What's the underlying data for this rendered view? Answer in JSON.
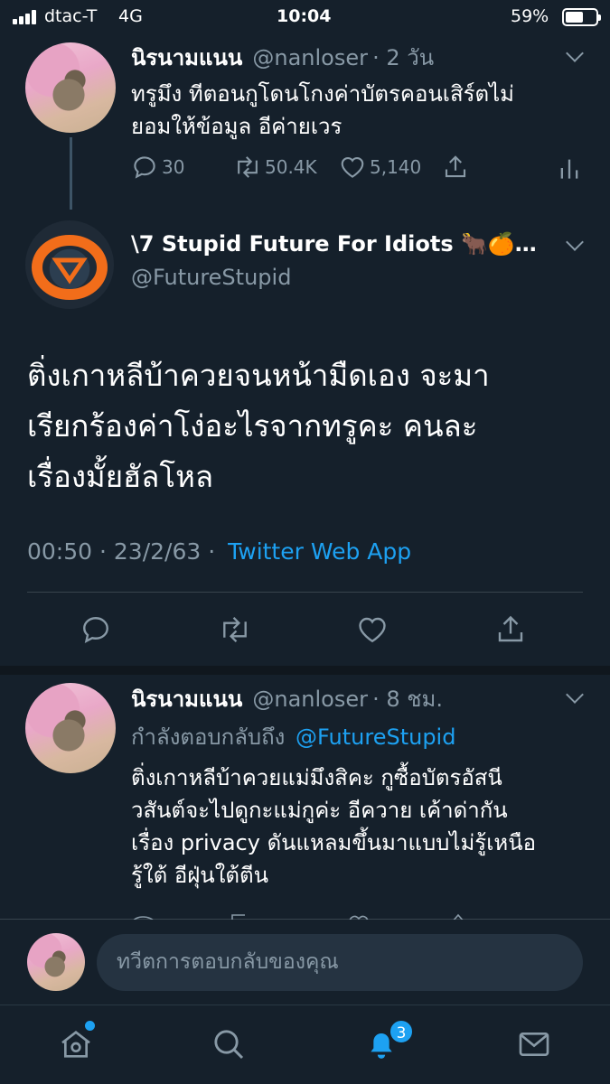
{
  "status_bar": {
    "carrier": "dtac-T",
    "network": "4G",
    "time": "10:04",
    "battery": "59%",
    "battery_level": 0.59
  },
  "parent_tweet": {
    "name": "นิรนามแนน",
    "handle": "@nanloser",
    "time": "· 2 วัน",
    "text_line1": "ทรูมึง ทีตอนกูโดนโกงค่าบัตรคอนเสิร์ตไม่",
    "text_line2": "ยอมให้ข้อมูล อีค่ายเวร",
    "replies": "30",
    "retweets": "50.4K",
    "likes": "5,140"
  },
  "main_tweet": {
    "name": "\\7 Stupid Future For Idiots 🐂🍊…",
    "handle": "@FutureStupid",
    "text_line1": "ติ่งเกาหลีบ้าควยจนหน้ามืดเอง จะมา",
    "text_line2": "เรียกร้องค่าโง่อะไรจากทรูคะ คนละ",
    "text_line3": "เรื่องมั้ยฮัลโหล",
    "timestamp": "00:50 · 23/2/63 ·",
    "source": "Twitter Web App"
  },
  "reply_tweet": {
    "name": "นิรนามแนน",
    "handle": "@nanloser",
    "time": "· 8 ชม.",
    "replying_prefix": "กำลังตอบกลับถึง",
    "replying_to": "@FutureStupid",
    "text_line1": "ติ่งเกาหลีบ้าควยแม่มึงสิคะ กูซื้อบัตรอัสนี",
    "text_line2": "วสันต์จะไปดูกะแม่กูค่ะ อีควาย เค้าด่ากัน",
    "text_line3": "เรื่อง privacy ดันแหลมขึ้นมาแบบไม่รู้เหนือ",
    "text_line4": "รู้ใต้ อีฝุ่นใต้ตีน"
  },
  "composer": {
    "placeholder": "ทวีตการตอบกลับของคุณ"
  },
  "tab_bar": {
    "notifications_badge": "3"
  },
  "colors": {
    "background": "#15202b",
    "muted": "#8899a6",
    "accent": "#1da1f2",
    "divider": "#38444d"
  }
}
